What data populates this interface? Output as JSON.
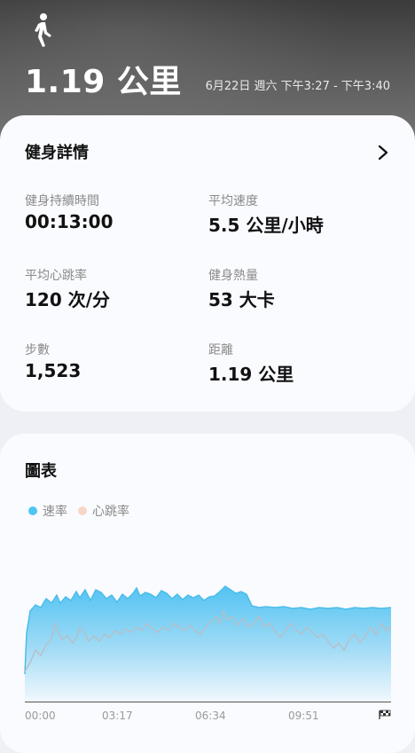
{
  "header": {
    "activity_icon": "walking-person-icon",
    "distance": "1.19 公里",
    "datetime": "6月22日 週六 下午3:27 - 下午3:40"
  },
  "details": {
    "title": "健身詳情",
    "chevron_icon": "chevron-right-icon",
    "stats": [
      {
        "label": "健身持續時間",
        "value": "00:13:00"
      },
      {
        "label": "平均速度",
        "value": "5.5 公里/小時"
      },
      {
        "label": "平均心跳率",
        "value": "120 次/分"
      },
      {
        "label": "健身熱量",
        "value": "53 大卡"
      },
      {
        "label": "步數",
        "value": "1,523"
      },
      {
        "label": "距離",
        "value": "1.19 公里"
      }
    ]
  },
  "chart": {
    "title": "圖表",
    "legend": [
      {
        "label": "速率",
        "color": "#4fc6f2"
      },
      {
        "label": "心跳率",
        "color": "#f7d6c9"
      }
    ],
    "x_ticks": [
      "00:00",
      "03:17",
      "06:34",
      "09:51"
    ],
    "end_icon": "checkered-flag-icon"
  }
}
